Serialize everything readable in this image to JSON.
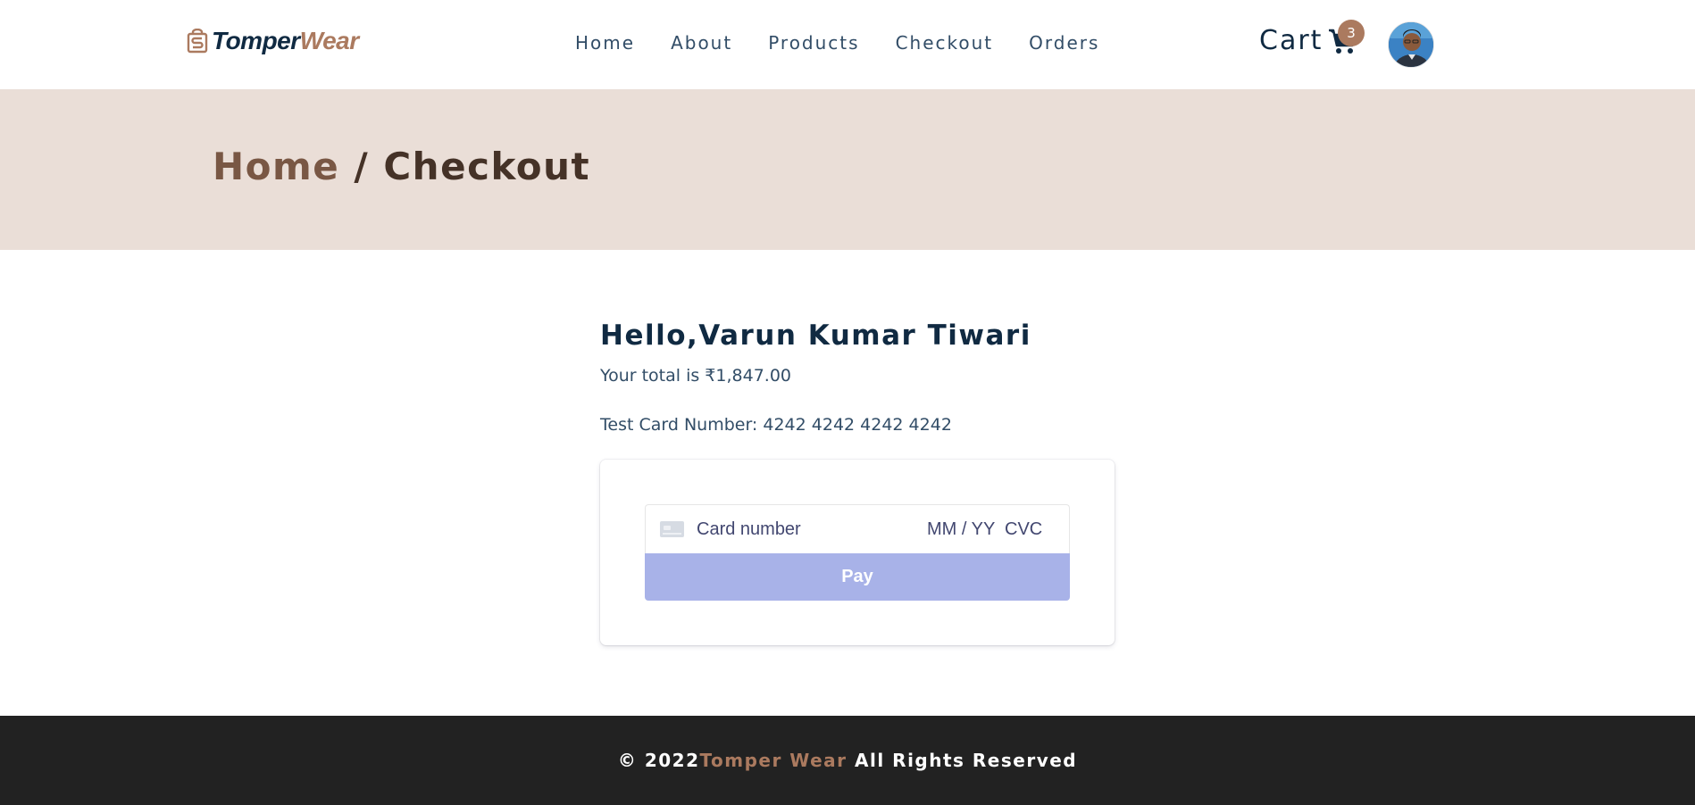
{
  "brand": {
    "part1": "Tomper",
    "part2": "Wear"
  },
  "nav": {
    "links": [
      "Home",
      "About",
      "Products",
      "Checkout",
      "Orders"
    ]
  },
  "cart": {
    "label": "Cart",
    "count": "3"
  },
  "hero": {
    "crumb": "Home",
    "separator": " / ",
    "current": "Checkout"
  },
  "checkout": {
    "greeting": "Hello,Varun Kumar Tiwari",
    "total": "Your total is ₹1,847.00",
    "test_card": "Test Card Number: 4242 4242 4242 4242",
    "card_number_placeholder": "Card number",
    "expiry_placeholder": "MM / YY",
    "cvc_placeholder": "CVC",
    "pay_label": "Pay"
  },
  "footer": {
    "year": "© 2022",
    "brand": "Tomper Wear",
    "rights": " All Rights Reserved"
  },
  "colors": {
    "accent": "#ab7a5f",
    "hero_bg": "#eaded7",
    "footer_bg": "#222222",
    "pay_button": "#a8b2e8",
    "heading": "#102a42"
  },
  "icons": {
    "logo": "shopping-bag-icon",
    "cart": "cart-icon",
    "card": "credit-card-icon"
  }
}
